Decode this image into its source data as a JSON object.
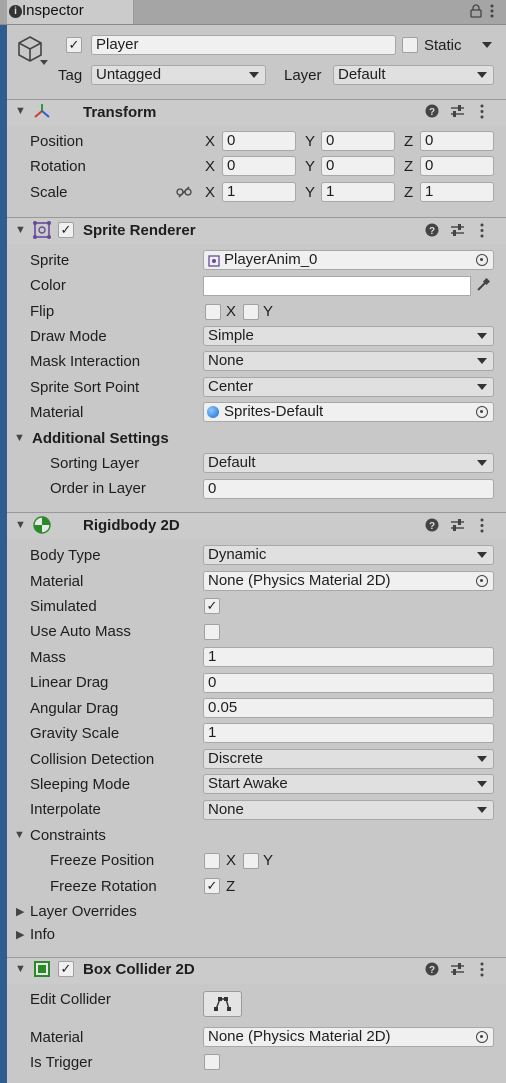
{
  "tab": {
    "title": "Inspector"
  },
  "go": {
    "name": "Player",
    "static_label": "Static",
    "tag_label": "Tag",
    "tag_value": "Untagged",
    "layer_label": "Layer",
    "layer_value": "Default"
  },
  "transform": {
    "title": "Transform",
    "position": {
      "label": "Position",
      "x": "0",
      "y": "0",
      "z": "0"
    },
    "rotation": {
      "label": "Rotation",
      "x": "0",
      "y": "0",
      "z": "0"
    },
    "scale": {
      "label": "Scale",
      "x": "1",
      "y": "1",
      "z": "1"
    },
    "axis": {
      "x": "X",
      "y": "Y",
      "z": "Z"
    }
  },
  "sprite_renderer": {
    "title": "Sprite Renderer",
    "sprite_label": "Sprite",
    "sprite_value": "PlayerAnim_0",
    "color_label": "Color",
    "flip_label": "Flip",
    "flip_x": "X",
    "flip_y": "Y",
    "draw_mode_label": "Draw Mode",
    "draw_mode_value": "Simple",
    "mask_label": "Mask Interaction",
    "mask_value": "None",
    "sort_point_label": "Sprite Sort Point",
    "sort_point_value": "Center",
    "material_label": "Material",
    "material_value": "Sprites-Default",
    "additional_label": "Additional Settings",
    "sorting_layer_label": "Sorting Layer",
    "sorting_layer_value": "Default",
    "order_label": "Order in Layer",
    "order_value": "0"
  },
  "rigidbody": {
    "title": "Rigidbody 2D",
    "body_type_label": "Body Type",
    "body_type_value": "Dynamic",
    "material_label": "Material",
    "material_value": "None (Physics Material 2D)",
    "simulated_label": "Simulated",
    "simulated_checked": true,
    "auto_mass_label": "Use Auto Mass",
    "auto_mass_checked": false,
    "mass_label": "Mass",
    "mass_value": "1",
    "linear_drag_label": "Linear Drag",
    "linear_drag_value": "0",
    "angular_drag_label": "Angular Drag",
    "angular_drag_value": "0.05",
    "gravity_label": "Gravity Scale",
    "gravity_value": "1",
    "collision_label": "Collision Detection",
    "collision_value": "Discrete",
    "sleeping_label": "Sleeping Mode",
    "sleeping_value": "Start Awake",
    "interpolate_label": "Interpolate",
    "interpolate_value": "None",
    "constraints_label": "Constraints",
    "freeze_pos_label": "Freeze Position",
    "freeze_pos_x": "X",
    "freeze_pos_y": "Y",
    "freeze_rot_label": "Freeze Rotation",
    "freeze_rot_z": "Z",
    "layer_overrides_label": "Layer Overrides",
    "info_label": "Info"
  },
  "box_collider": {
    "title": "Box Collider 2D",
    "edit_label": "Edit Collider",
    "material_label": "Material",
    "material_value": "None (Physics Material 2D)",
    "trigger_label": "Is Trigger"
  },
  "icons": {
    "help": "help-icon",
    "presets": "presets-icon",
    "more": "kebab-menu-icon",
    "picker": "object-picker-icon",
    "eyedropper": "eyedropper-icon",
    "link": "constrain-proportions-icon",
    "lock": "lock-icon"
  },
  "colors": {
    "panel": "#c8c8c8",
    "header": "#cbcbcb",
    "field": "#f0f0f0",
    "accent": "#2e5d8f"
  }
}
